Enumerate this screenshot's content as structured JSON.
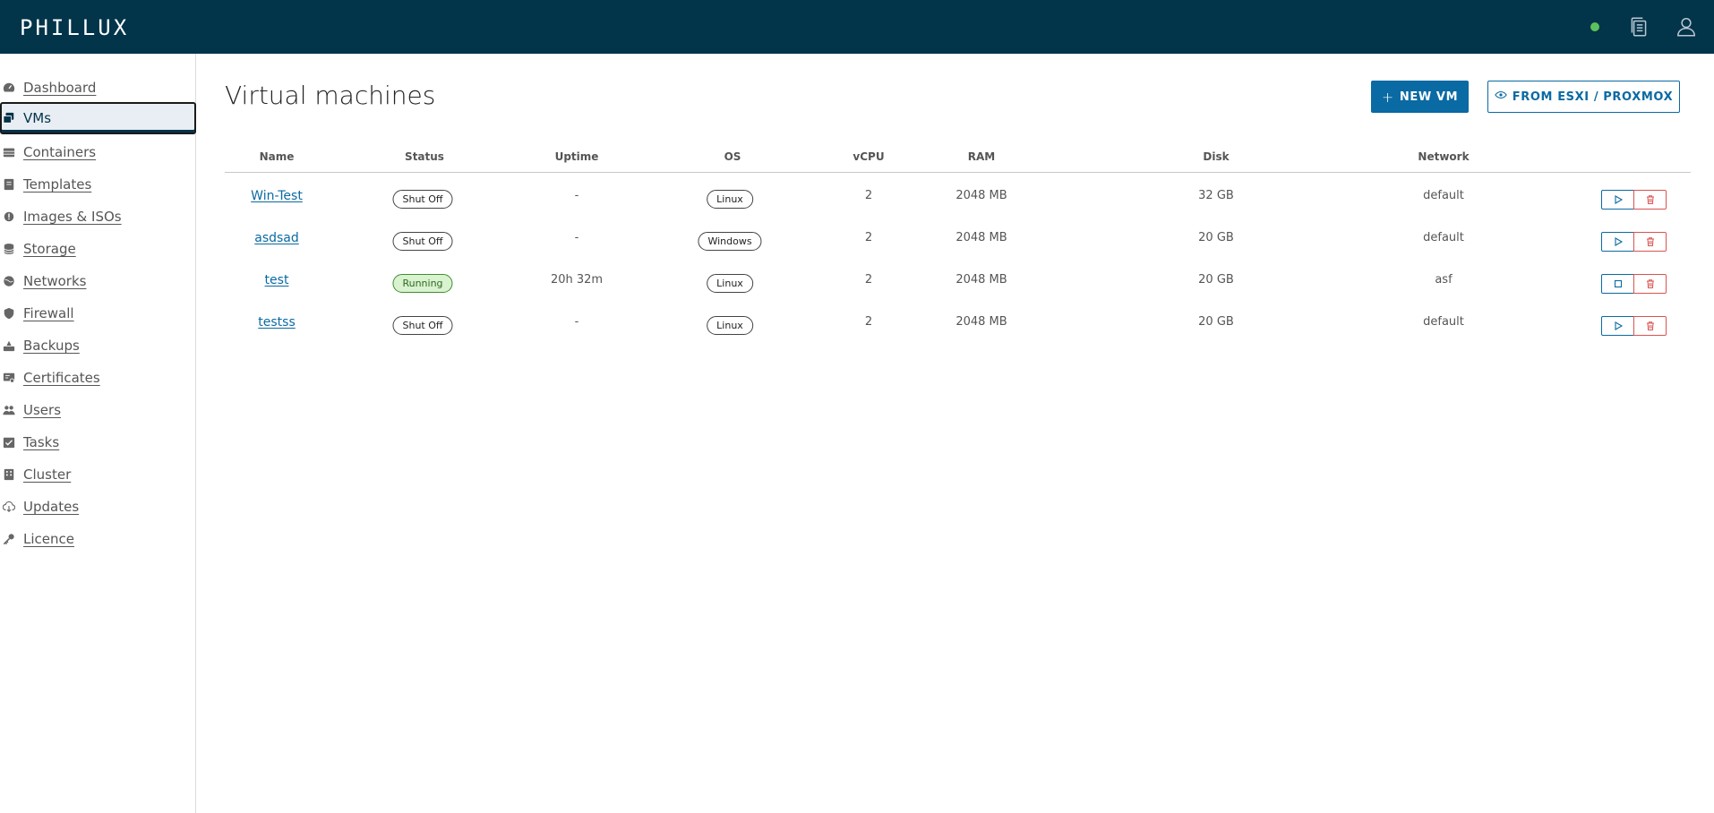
{
  "app": {
    "logo": "PHILLUX"
  },
  "colors": {
    "header_bg": "#02344a",
    "accent": "#0a6aa3",
    "danger": "#d9534f",
    "online": "#5cc15a",
    "running_bg": "#d9f2d0"
  },
  "header": {
    "status_icon": "online-dot-icon",
    "icons": [
      "copy-icon",
      "user-icon"
    ]
  },
  "sidebar": {
    "items": [
      {
        "label": "Dashboard",
        "icon": "dashboard-icon"
      },
      {
        "label": "VMs",
        "icon": "vm-icon"
      },
      {
        "label": "Containers",
        "icon": "containers-icon"
      },
      {
        "label": "Templates",
        "icon": "templates-icon"
      },
      {
        "label": "Images & ISOs",
        "icon": "disc-icon"
      },
      {
        "label": "Storage",
        "icon": "database-icon"
      },
      {
        "label": "Networks",
        "icon": "network-icon"
      },
      {
        "label": "Firewall",
        "icon": "shield-icon"
      },
      {
        "label": "Backups",
        "icon": "backup-icon"
      },
      {
        "label": "Certificates",
        "icon": "certificate-icon"
      },
      {
        "label": "Users",
        "icon": "users-icon"
      },
      {
        "label": "Tasks",
        "icon": "tasks-icon"
      },
      {
        "label": "Cluster",
        "icon": "cluster-icon"
      },
      {
        "label": "Updates",
        "icon": "cloud-download-icon"
      },
      {
        "label": "Licence",
        "icon": "key-icon"
      }
    ],
    "active": "VMs"
  },
  "main": {
    "title": "Virtual machines",
    "new_vm_label": "NEW VM",
    "import_label": "FROM ESXI / PROXMOX",
    "columns": [
      "Name",
      "Status",
      "Uptime",
      "OS",
      "vCPU",
      "RAM",
      "Disk",
      "Network"
    ],
    "rows": [
      {
        "name": "Win-Test",
        "status": "Shut Off",
        "uptime": "-",
        "os": "Linux",
        "vcpu": "2",
        "ram": "2048 MB",
        "disk": "32 GB",
        "network": "default",
        "action": "start"
      },
      {
        "name": "asdsad",
        "status": "Shut Off",
        "uptime": "-",
        "os": "Windows",
        "vcpu": "2",
        "ram": "2048 MB",
        "disk": "20 GB",
        "network": "default",
        "action": "start"
      },
      {
        "name": "test",
        "status": "Running",
        "uptime": "20h 32m",
        "os": "Linux",
        "vcpu": "2",
        "ram": "2048 MB",
        "disk": "20 GB",
        "network": "asf",
        "action": "stop"
      },
      {
        "name": "testss",
        "status": "Shut Off",
        "uptime": "-",
        "os": "Linux",
        "vcpu": "2",
        "ram": "2048 MB",
        "disk": "20 GB",
        "network": "default",
        "action": "start"
      }
    ]
  }
}
